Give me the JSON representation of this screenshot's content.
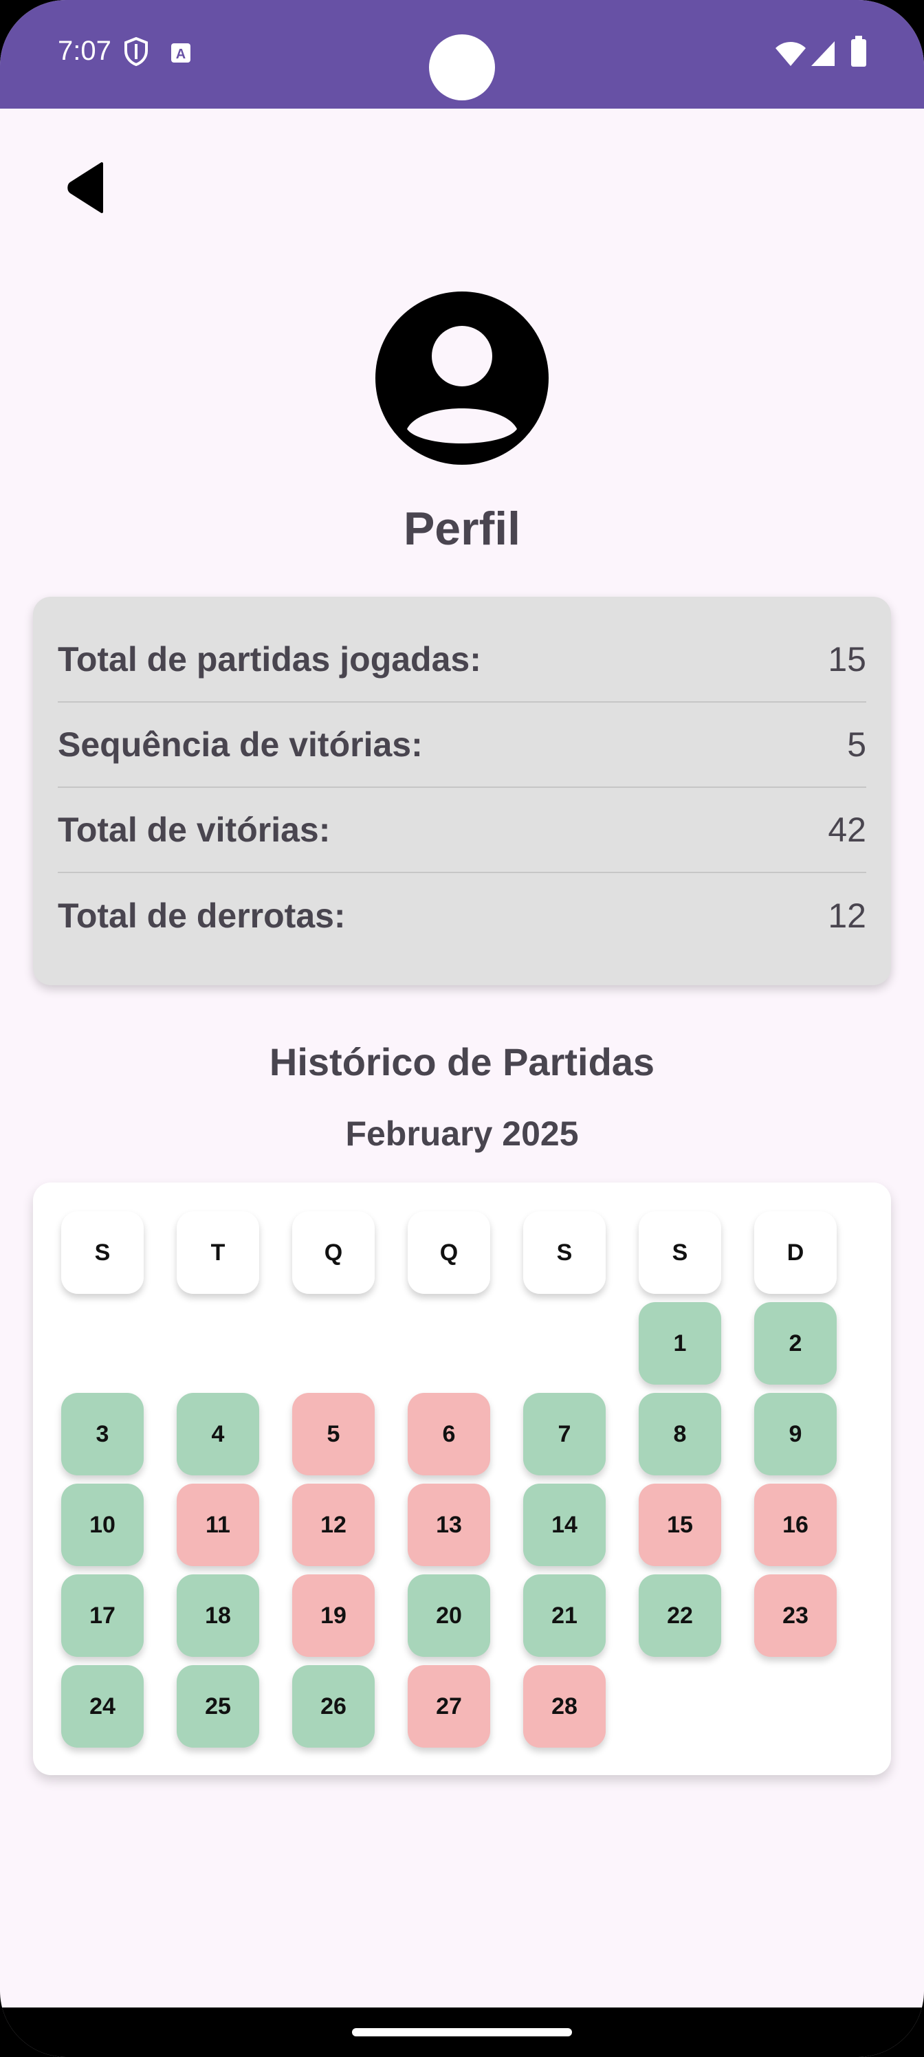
{
  "status_bar": {
    "time": "7:07",
    "icons": [
      "shield-icon",
      "translate-icon",
      "wifi-icon",
      "signal-icon",
      "battery-icon"
    ],
    "color": "#6751a5"
  },
  "header": {
    "back_icon": "back-arrow-icon",
    "avatar_icon": "account-circle-icon",
    "title": "Perfil"
  },
  "stats": [
    {
      "label": "Total de partidas jogadas:",
      "value": "15"
    },
    {
      "label": "Sequência de vitórias:",
      "value": "5"
    },
    {
      "label": "Total de vitórias:",
      "value": "42"
    },
    {
      "label": "Total de derrotas:",
      "value": "12"
    }
  ],
  "history": {
    "title": "Histórico de Partidas",
    "month": "February 2025",
    "weekdays": [
      "S",
      "T",
      "Q",
      "Q",
      "S",
      "S",
      "D"
    ],
    "first_weekday_index": 5,
    "colors": {
      "win": "#a8d5ba",
      "loss": "#f5b7b7"
    },
    "days": [
      {
        "day": "1",
        "result": "win"
      },
      {
        "day": "2",
        "result": "win"
      },
      {
        "day": "3",
        "result": "win"
      },
      {
        "day": "4",
        "result": "win"
      },
      {
        "day": "5",
        "result": "loss"
      },
      {
        "day": "6",
        "result": "loss"
      },
      {
        "day": "7",
        "result": "win"
      },
      {
        "day": "8",
        "result": "win"
      },
      {
        "day": "9",
        "result": "win"
      },
      {
        "day": "10",
        "result": "win"
      },
      {
        "day": "11",
        "result": "loss"
      },
      {
        "day": "12",
        "result": "loss"
      },
      {
        "day": "13",
        "result": "loss"
      },
      {
        "day": "14",
        "result": "win"
      },
      {
        "day": "15",
        "result": "loss"
      },
      {
        "day": "16",
        "result": "loss"
      },
      {
        "day": "17",
        "result": "win"
      },
      {
        "day": "18",
        "result": "win"
      },
      {
        "day": "19",
        "result": "loss"
      },
      {
        "day": "20",
        "result": "win"
      },
      {
        "day": "21",
        "result": "win"
      },
      {
        "day": "22",
        "result": "win"
      },
      {
        "day": "23",
        "result": "loss"
      },
      {
        "day": "24",
        "result": "win"
      },
      {
        "day": "25",
        "result": "win"
      },
      {
        "day": "26",
        "result": "win"
      },
      {
        "day": "27",
        "result": "loss"
      },
      {
        "day": "28",
        "result": "loss"
      }
    ]
  }
}
